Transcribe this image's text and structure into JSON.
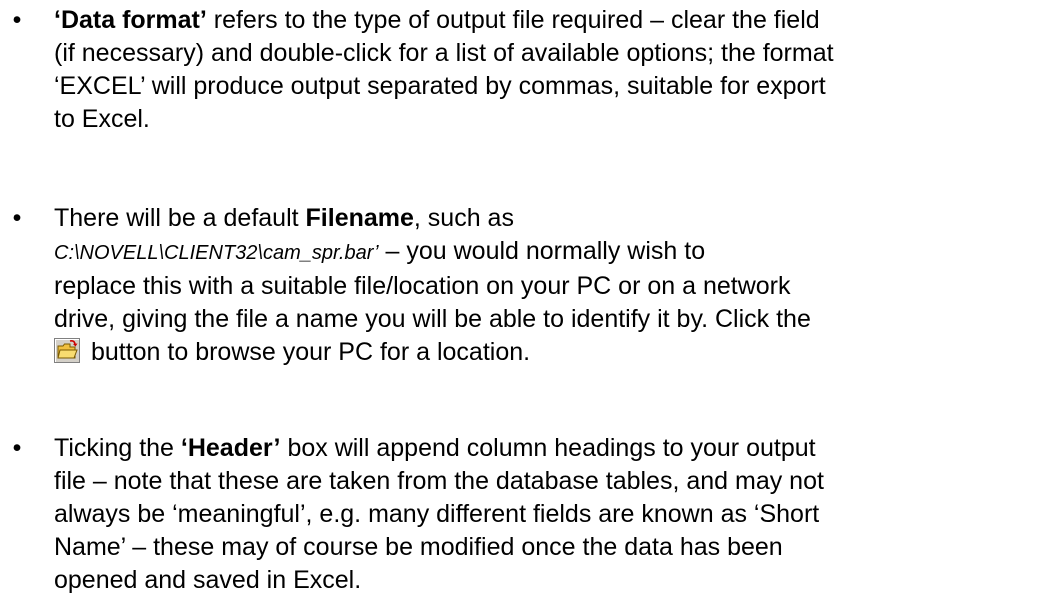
{
  "bullet_glyph": "•",
  "items": [
    {
      "lines": [
        {
          "bold": "‘Data format’",
          "text": " refers to the type of output file required – clear the field"
        },
        {
          "text": "(if necessary) and double-click for a list of available options; the format"
        },
        {
          "text": "‘EXCEL’ will produce output separated by commas, suitable for export"
        },
        {
          "text": "to Excel."
        }
      ]
    },
    {
      "lines": [
        {
          "pre": "There will be a default ",
          "bold": "Filename",
          "text": ", such as"
        },
        {
          "path": "C:\\NOVELL\\CLIENT32\\cam_spr.bar’",
          "text": " – you would normally wish to"
        },
        {
          "text": "replace this with a suitable file/location on your PC or on a network"
        },
        {
          "text": "drive, giving the file a name you will be able to identify it by. Click the"
        },
        {
          "text": " button to browse your PC for a location."
        }
      ],
      "icon": "folder-open-icon"
    },
    {
      "lines": [
        {
          "pre": "Ticking the ",
          "bold": "‘Header’",
          "text": " box will append column headings to your output"
        },
        {
          "text": "file – note that these are taken from the database tables, and may not"
        },
        {
          "text": "always be ‘meaningful’, e.g. many different fields are known as ‘Short"
        },
        {
          "text": "Name’ – these may of course be modified once the data has been"
        },
        {
          "text": "opened and saved in Excel."
        }
      ]
    }
  ]
}
